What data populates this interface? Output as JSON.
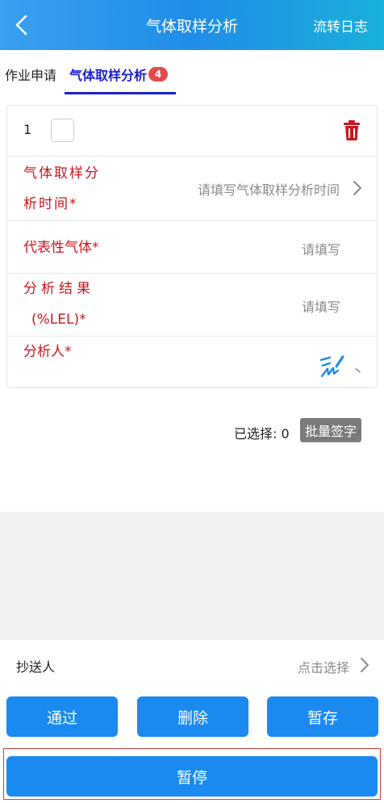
{
  "header": {
    "back_icon": "chevron-left-icon",
    "title": "气体取样分析",
    "right_link": "流转日志"
  },
  "tabs": [
    {
      "label": "作业申请",
      "active": false
    },
    {
      "label": "气体取样分析",
      "active": true,
      "badge": "4"
    }
  ],
  "record": {
    "index": "1",
    "checked": false,
    "delete_icon": "trash-icon",
    "fields": {
      "analysis_time": {
        "label_line1": "气体取样分",
        "label_line2": "析时间*",
        "placeholder": "请填写气体取样分析时间"
      },
      "representative_gas": {
        "label": "代表性气体*",
        "placeholder": "请填写"
      },
      "result": {
        "label_line1": "分析结果",
        "label_line2": "(%LEL)*",
        "placeholder": "请填写"
      },
      "analyst": {
        "label": "分析人*",
        "sign_icon": "signature-icon"
      }
    }
  },
  "selection": {
    "selected_text": "已选择: 0",
    "batch_sign": "批量签字"
  },
  "cc": {
    "label": "抄送人",
    "value": "点击选择"
  },
  "actions": {
    "pass": "通过",
    "delete": "删除",
    "save": "暂存",
    "pause": "暂停"
  },
  "colors": {
    "primary": "#1a8af0",
    "required_label": "#c8161d",
    "active_tab": "#1a1fd0",
    "badge": "#e24b4b"
  }
}
